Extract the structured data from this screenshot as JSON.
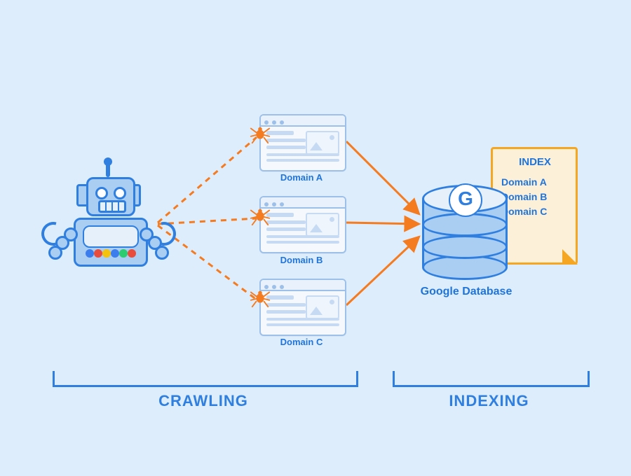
{
  "robot": {
    "dot_colors": [
      "#3b7ded",
      "#e84c3d",
      "#f4c20d",
      "#3b7ded",
      "#2ecc71",
      "#e84c3d"
    ]
  },
  "domains": {
    "a": "Domain A",
    "b": "Domain B",
    "c": "Domain C"
  },
  "database": {
    "badge": "G",
    "label": "Google Database"
  },
  "index_sheet": {
    "title": "INDEX",
    "rows": [
      "Domain A",
      "Domain B",
      "Domain C"
    ]
  },
  "phases": {
    "crawling": "CRAWLING",
    "indexing": "INDEXING"
  },
  "colors": {
    "arrow_dashed": "#f47b20",
    "arrow_solid": "#f47b20"
  }
}
